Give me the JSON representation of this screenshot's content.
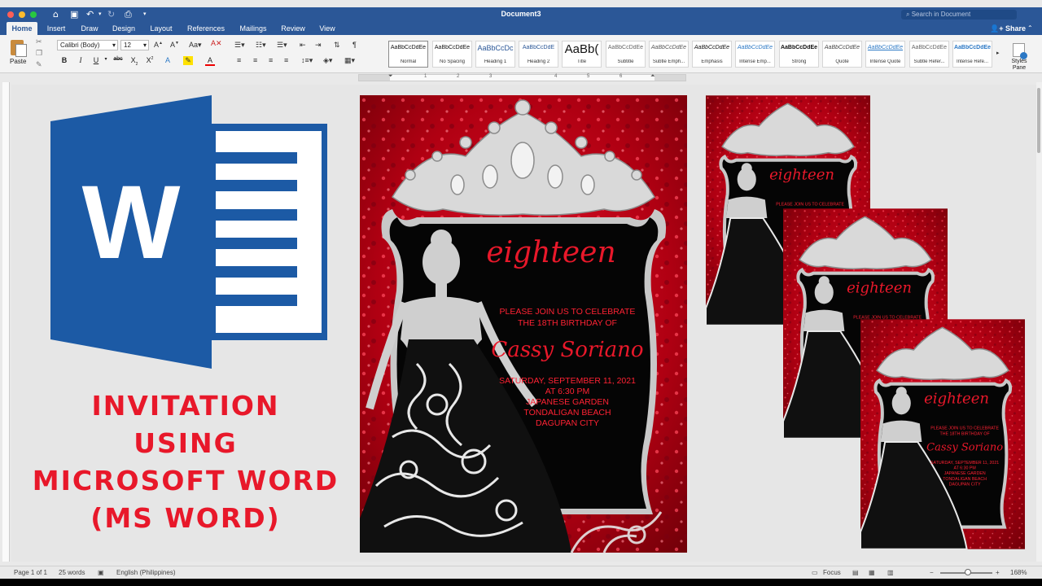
{
  "titlebar": {
    "document_title": "Document3",
    "search_placeholder": "Search in Document"
  },
  "tabs": [
    {
      "label": "Home"
    },
    {
      "label": "Insert"
    },
    {
      "label": "Draw"
    },
    {
      "label": "Design"
    },
    {
      "label": "Layout"
    },
    {
      "label": "References"
    },
    {
      "label": "Mailings"
    },
    {
      "label": "Review"
    },
    {
      "label": "View"
    }
  ],
  "share_label": "Share",
  "ribbon": {
    "paste_label": "Paste",
    "font_name": "Calibri (Body)",
    "font_size": "12",
    "styles": [
      {
        "sample": "AaBbCcDdEe",
        "name": "Normal"
      },
      {
        "sample": "AaBbCcDdEe",
        "name": "No Spacing"
      },
      {
        "sample": "AaBbCcDc",
        "name": "Heading 1"
      },
      {
        "sample": "AaBbCcDdE",
        "name": "Heading 2"
      },
      {
        "sample": "AaBb(",
        "name": "Title"
      },
      {
        "sample": "AaBbCcDdEe",
        "name": "Subtitle"
      },
      {
        "sample": "AaBbCcDdEe",
        "name": "Subtle Emph..."
      },
      {
        "sample": "AaBbCcDdEe",
        "name": "Emphasis"
      },
      {
        "sample": "AaBbCcDdEe",
        "name": "Intense Emp..."
      },
      {
        "sample": "AaBbCcDdEe",
        "name": "Strong"
      },
      {
        "sample": "AaBbCcDdEe",
        "name": "Quote"
      },
      {
        "sample": "AaBbCcDdEe",
        "name": "Intense Quote"
      },
      {
        "sample": "AaBbCcDdEe",
        "name": "Subtle Refer..."
      },
      {
        "sample": "AaBbCcDdEe",
        "name": "Intense Refe..."
      }
    ],
    "styles_pane_label": "Styles Pane"
  },
  "ruler_numbers": [
    "1",
    "2",
    "3",
    "4",
    "5",
    "6"
  ],
  "document": {
    "title_lines": [
      "INVITATION",
      "USING",
      "MICROSOFT WORD",
      "(MS WORD)"
    ],
    "invitation": {
      "script_title": "eighteen",
      "line1": "PLEASE JOIN US TO CELEBRATE",
      "line2": "THE 18TH BIRTHDAY OF",
      "name": "Cassy Soriano",
      "date": "SATURDAY, SEPTEMBER 11, 2021",
      "time": "AT 6:30 PM",
      "venue1": "JAPANESE GARDEN",
      "venue2": "TONDALIGAN BEACH",
      "venue3": "DAGUPAN CITY"
    }
  },
  "statusbar": {
    "page": "Page 1 of 1",
    "words": "25 words",
    "language": "English (Philippines)",
    "focus": "Focus",
    "zoom": "168%"
  },
  "colors": {
    "word_blue": "#1c5aa5",
    "title_bar": "#2b5797",
    "invite_red": "#e8182a",
    "glitter_red": "#b00012"
  }
}
